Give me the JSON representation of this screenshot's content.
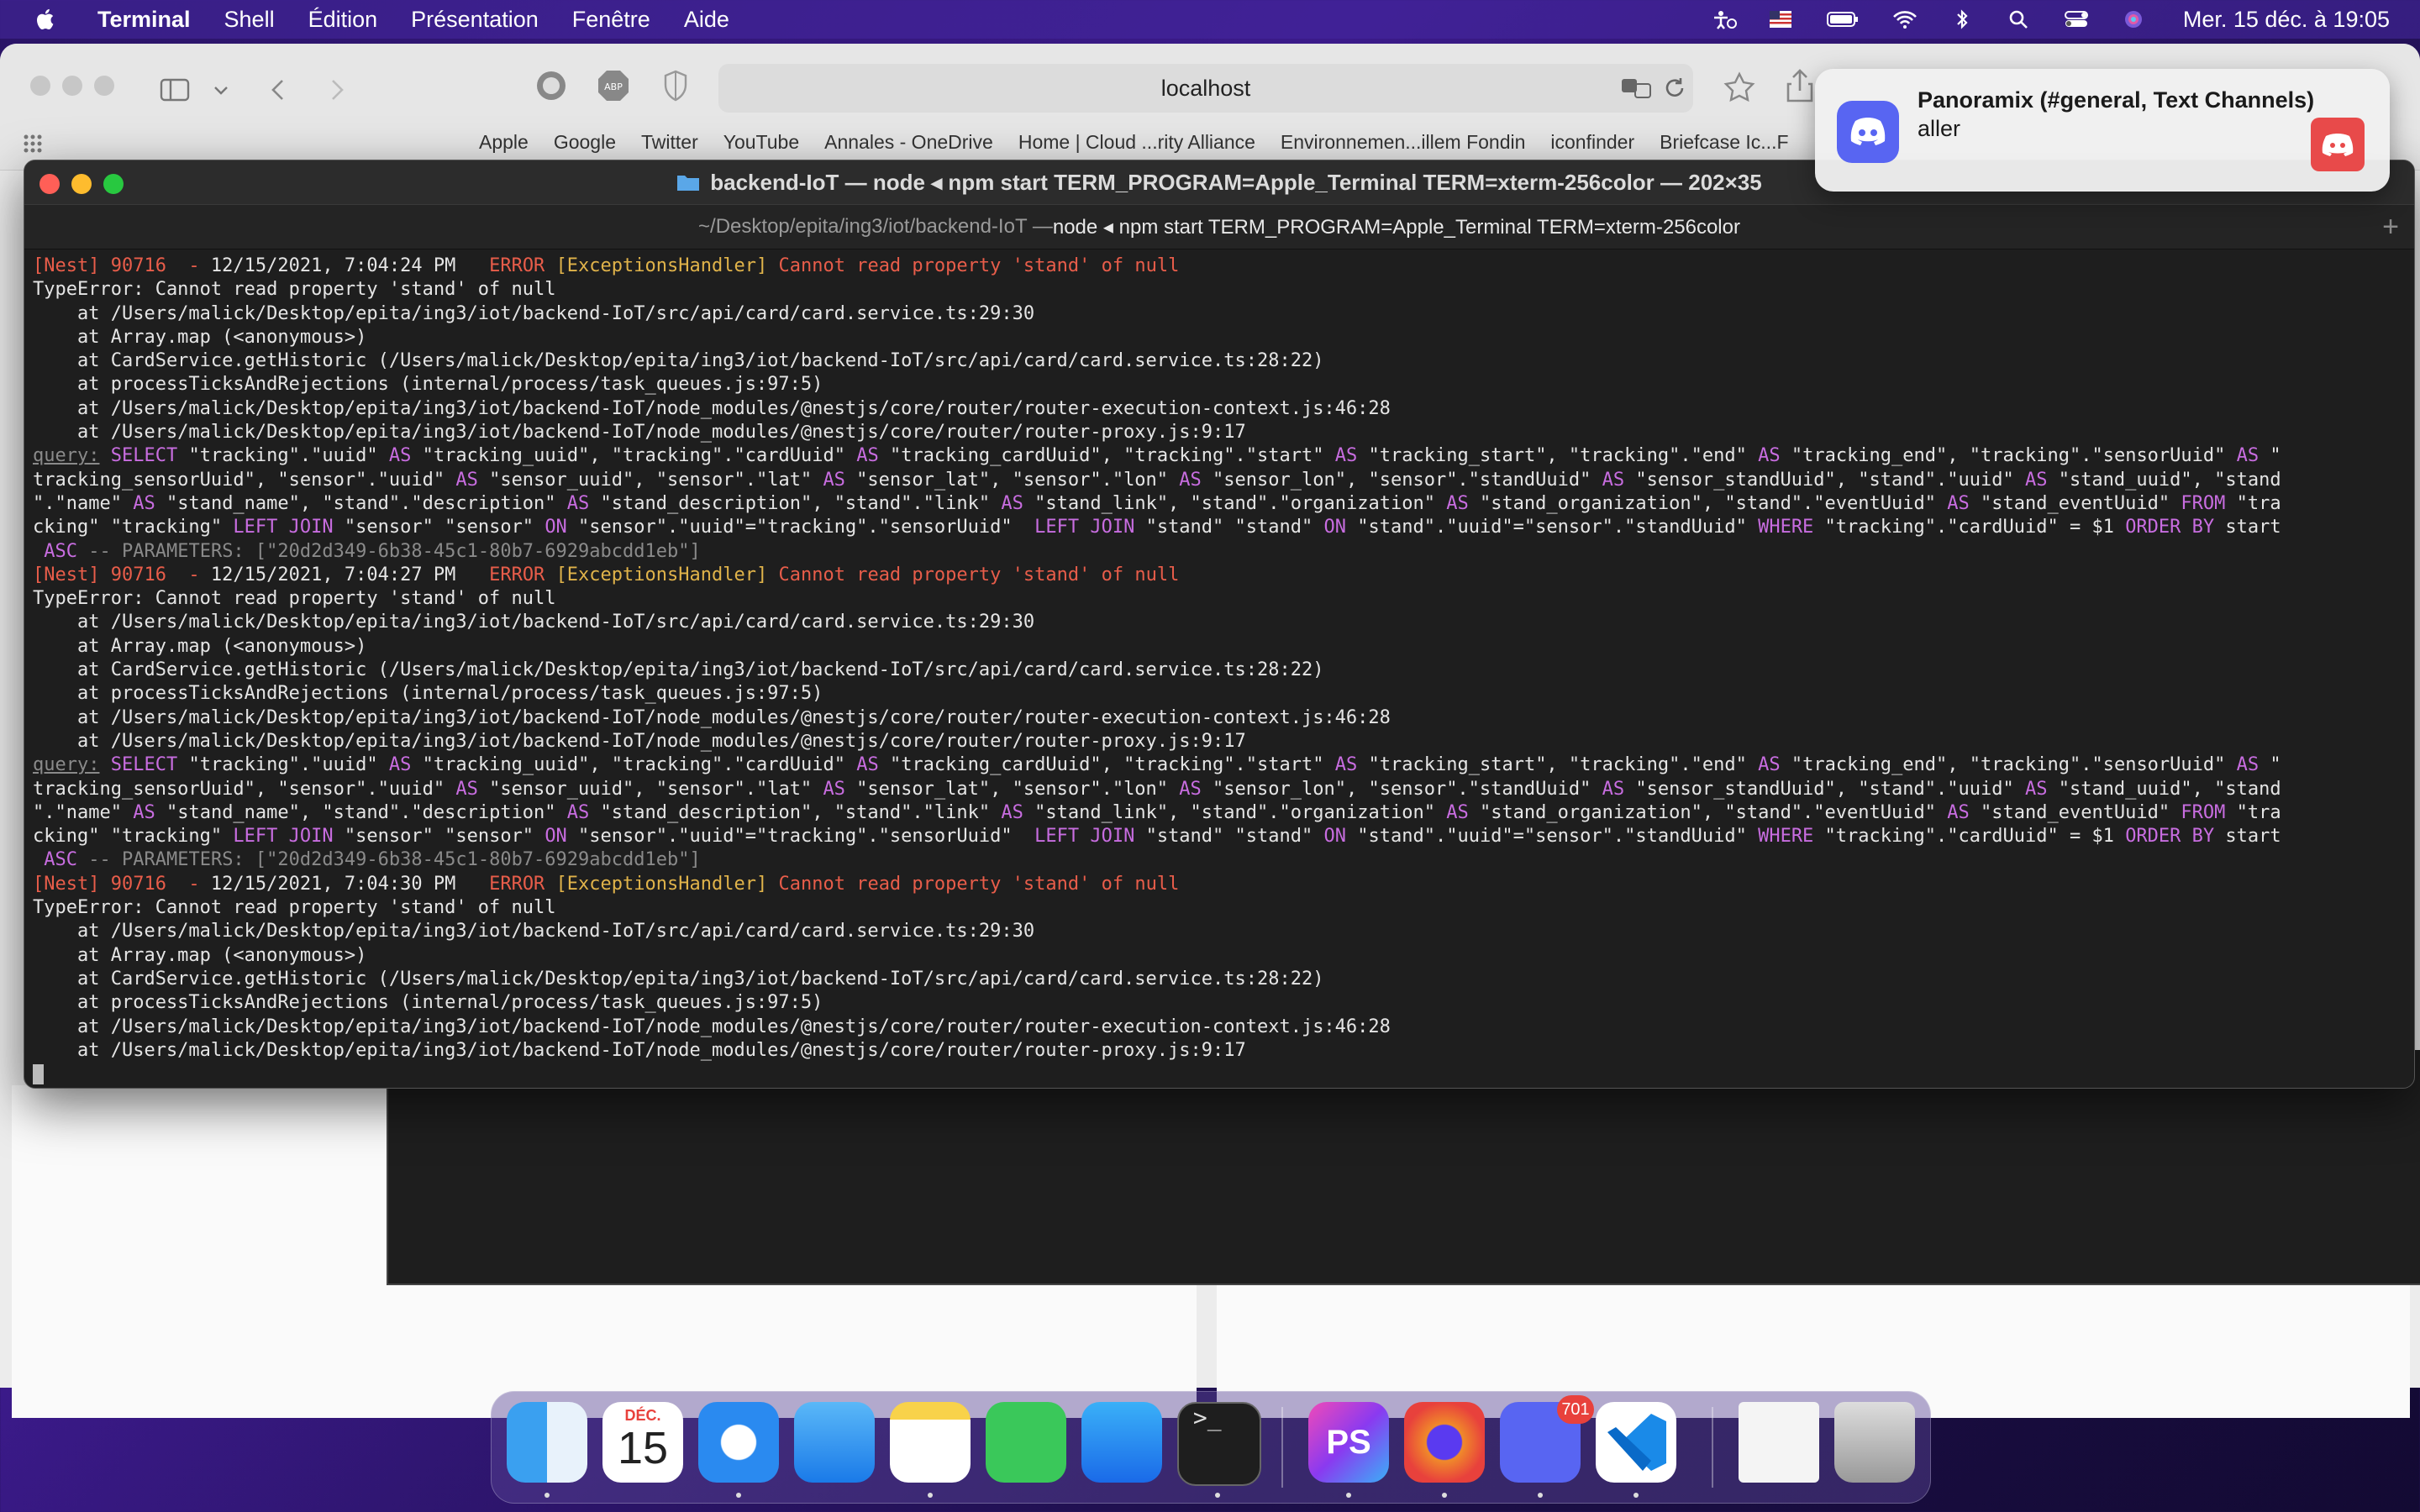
{
  "menubar": {
    "app_name": "Terminal",
    "menus": [
      "Shell",
      "Édition",
      "Présentation",
      "Fenêtre",
      "Aide"
    ],
    "clock": "Mer. 15 déc. à  19:05"
  },
  "browser": {
    "url": "localhost",
    "bookmarks": [
      "Apple",
      "Google",
      "Twitter",
      "YouTube",
      "Annales - OneDrive",
      "Home | Cloud ...rity Alliance",
      "Environnemen...illem Fondin",
      "iconfinder",
      "Briefcase Ic...F"
    ]
  },
  "terminal": {
    "title": "backend-IoT — node ◂ npm start TERM_PROGRAM=Apple_Terminal TERM=xterm-256color — 202×35",
    "tab_path": "~/Desktop/epita/ing3/iot/backend-IoT — ",
    "tab_cmd": "node ◂ npm start TERM_PROGRAM=Apple_Terminal TERM=xterm-256color",
    "plus": "+",
    "nest_tag": "[Nest] 90716  - ",
    "error_level": "ERROR",
    "handler": "[ExceptionsHandler]",
    "error_msg": "Cannot read property 'stand' of null",
    "type_error": "TypeError: Cannot read property 'stand' of null",
    "timestamps": [
      "12/15/2021, 7:04:24 PM",
      "12/15/2021, 7:04:27 PM",
      "12/15/2021, 7:04:30 PM"
    ],
    "stack": [
      "    at /Users/malick/Desktop/epita/ing3/iot/backend-IoT/src/api/card/card.service.ts:29:30",
      "    at Array.map (<anonymous>)",
      "    at CardService.getHistoric (/Users/malick/Desktop/epita/ing3/iot/backend-IoT/src/api/card/card.service.ts:28:22)",
      "    at processTicksAndRejections (internal/process/task_queues.js:97:5)",
      "    at /Users/malick/Desktop/epita/ing3/iot/backend-IoT/node_modules/@nestjs/core/router/router-execution-context.js:46:28",
      "    at /Users/malick/Desktop/epita/ing3/iot/backend-IoT/node_modules/@nestjs/core/router/router-proxy.js:9:17"
    ],
    "query_label": "query:",
    "query_lines": [
      " SELECT \"tracking\".\"uuid\" AS \"tracking_uuid\", \"tracking\".\"cardUuid\" AS \"tracking_cardUuid\", \"tracking\".\"start\" AS \"tracking_start\", \"tracking\".\"end\" AS \"tracking_end\", \"tracking\".\"sensorUuid\" AS \"",
      "tracking_sensorUuid\", \"sensor\".\"uuid\" AS \"sensor_uuid\", \"sensor\".\"lat\" AS \"sensor_lat\", \"sensor\".\"lon\" AS \"sensor_lon\", \"sensor\".\"standUuid\" AS \"sensor_standUuid\", \"stand\".\"uuid\" AS \"stand_uuid\", \"stand",
      "\".\"name\" AS \"stand_name\", \"stand\".\"description\" AS \"stand_description\", \"stand\".\"link\" AS \"stand_link\", \"stand\".\"organization\" AS \"stand_organization\", \"stand\".\"eventUuid\" AS \"stand_eventUuid\" FROM \"tra",
      "cking\" \"tracking\" LEFT JOIN \"sensor\" \"sensor\" ON \"sensor\".\"uuid\"=\"tracking\".\"sensorUuid\"  LEFT JOIN \"stand\" \"stand\" ON \"stand\".\"uuid\"=\"sensor\".\"standUuid\" WHERE \"tracking\".\"cardUuid\" = $1 ORDER BY start",
      " ASC -- PARAMETERS: [\"20d2d349-6b38-45c1-80b7-6929abcdd1eb\"]"
    ]
  },
  "notification": {
    "title": "Panoramix (#general, Text Channels)",
    "message": "aller"
  },
  "dock": {
    "calendar_month": "DÉC.",
    "calendar_day": "15",
    "discord_badge": "701"
  }
}
